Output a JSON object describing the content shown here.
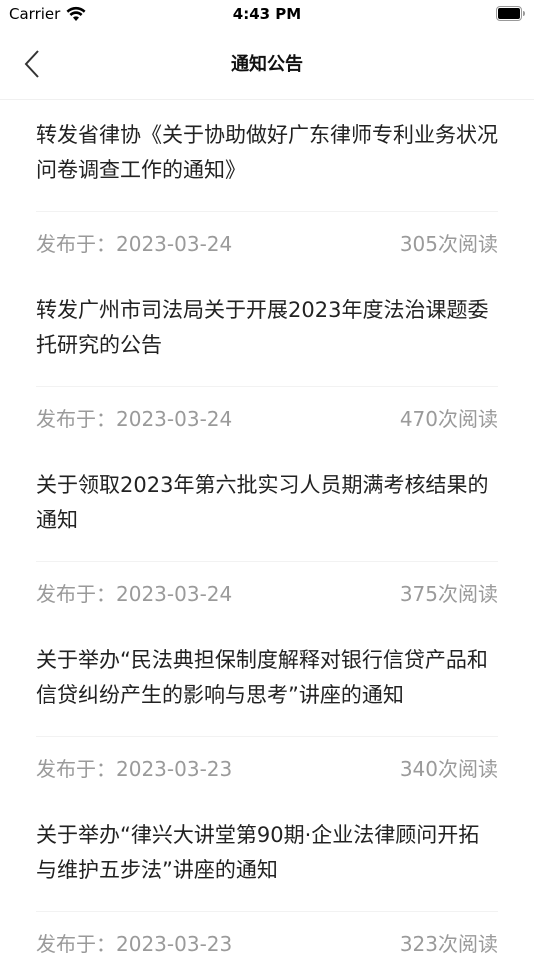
{
  "status_bar": {
    "carrier": "Carrier",
    "time": "4:43 PM"
  },
  "nav": {
    "title": "通知公告",
    "back_icon": "chevron-left-icon"
  },
  "colors": {
    "title_text": "#222222",
    "meta_text": "#9a9a9a",
    "divider": "#f2f2f2"
  },
  "notices": [
    {
      "title": "转发省律协《关于协助做好广东律师专利业务状况问卷调查工作的通知》",
      "date": "发布于：2023-03-24",
      "views": "305次阅读"
    },
    {
      "title": "转发广州市司法局关于开展2023年度法治课题委托研究的公告",
      "date": "发布于：2023-03-24",
      "views": "470次阅读"
    },
    {
      "title": "关于领取2023年第六批实习人员期满考核结果的通知",
      "date": "发布于：2023-03-24",
      "views": "375次阅读"
    },
    {
      "title": "关于举办“民法典担保制度解释对银行信贷产品和信贷纠纷产生的影响与思考”讲座的通知",
      "date": "发布于：2023-03-23",
      "views": "340次阅读"
    },
    {
      "title": "关于举办“律兴大讲堂第90期·企业法律顾问开拓与维护五步法”讲座的通知",
      "date": "发布于：2023-03-23",
      "views": "323次阅读"
    }
  ]
}
